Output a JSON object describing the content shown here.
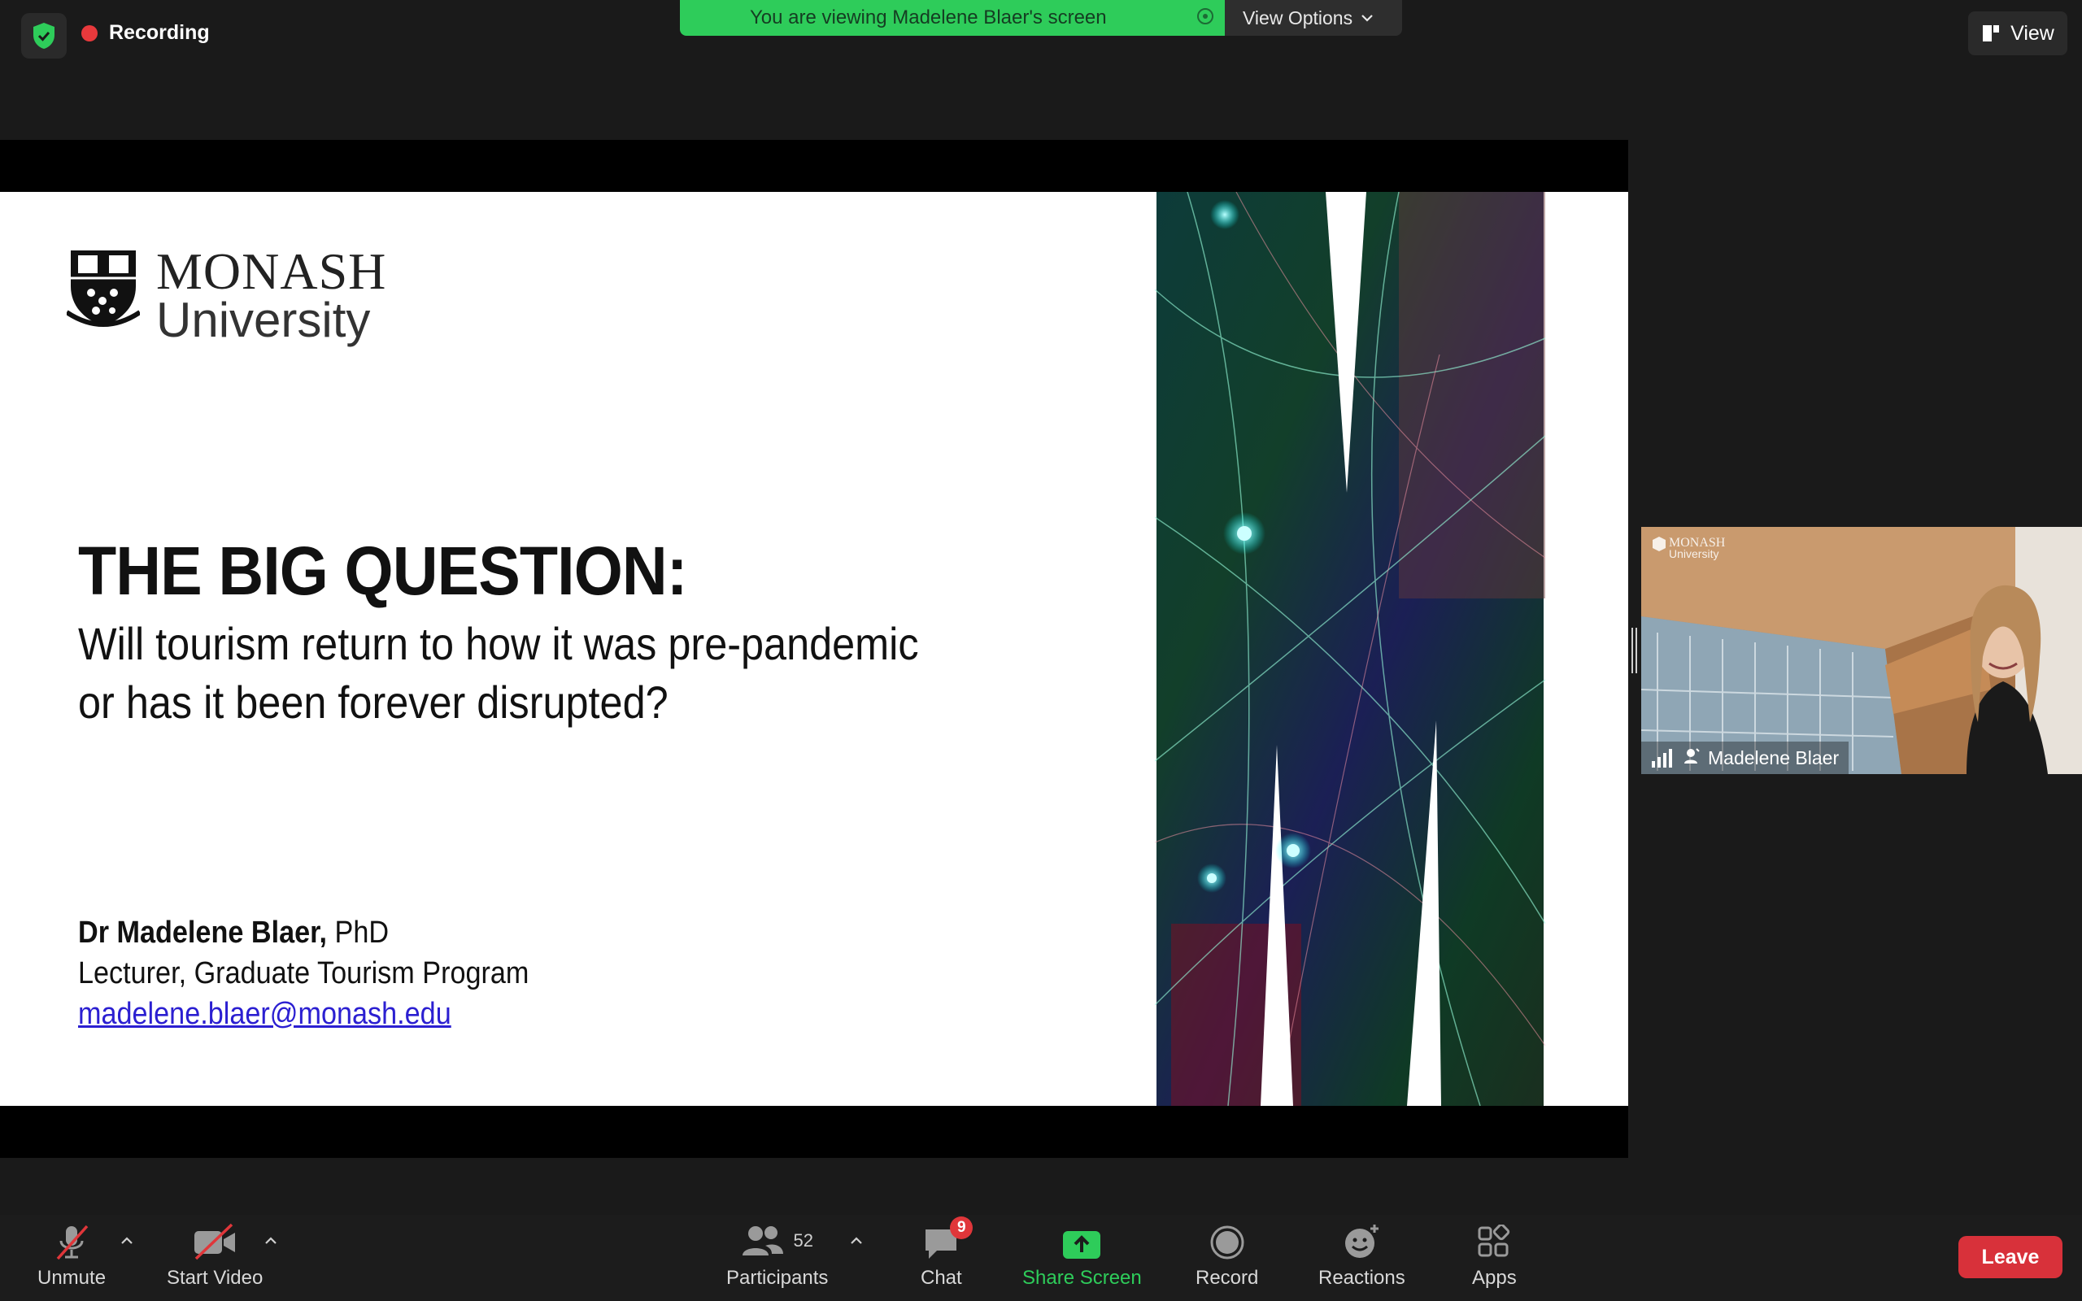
{
  "top": {
    "recording_label": "Recording",
    "banner_text": "You are viewing Madelene Blaer's screen",
    "view_options_label": "View Options",
    "view_label": "View"
  },
  "slide": {
    "logo_line1": "MONASH",
    "logo_line2": "University",
    "title": "THE BIG QUESTION:",
    "subtitle": "Will tourism return to how it was pre-pandemic or has it been forever disrupted?",
    "author_name": "Dr Madelene Blaer,",
    "author_degree": " PhD",
    "author_role": "Lecturer, Graduate Tourism Program",
    "author_email": "madelene.blaer@monash.edu"
  },
  "tile": {
    "name": "Madelene Blaer",
    "logo_line1": "MONASH",
    "logo_line2": "University"
  },
  "toolbar": {
    "unmute": "Unmute",
    "start_video": "Start Video",
    "participants": "Participants",
    "participant_count": "52",
    "chat": "Chat",
    "chat_badge": "9",
    "share_screen": "Share Screen",
    "record": "Record",
    "reactions": "Reactions",
    "apps": "Apps",
    "leave": "Leave"
  },
  "colors": {
    "banner": "#2ecc5a",
    "share_green": "#2ecc5a",
    "leave_red": "#d8313a",
    "recording_red": "#e8393c"
  }
}
